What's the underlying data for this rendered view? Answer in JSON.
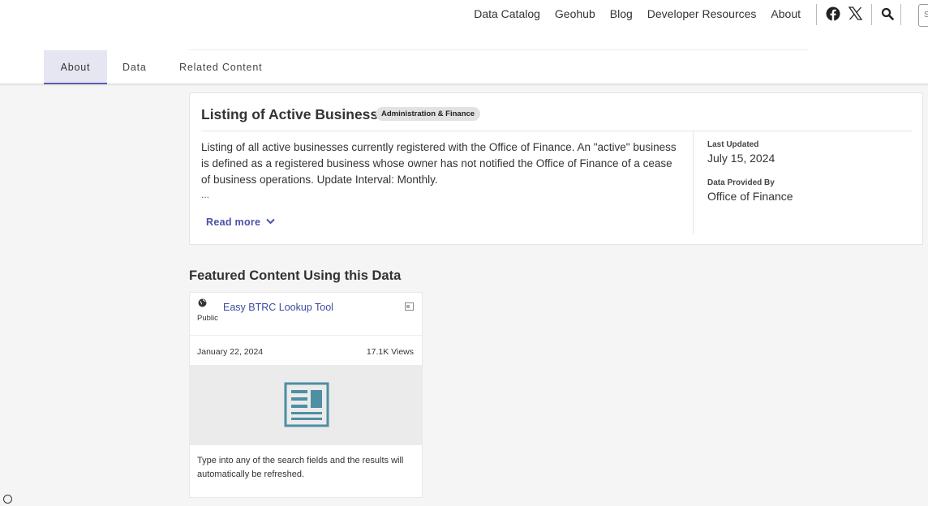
{
  "nav": {
    "links": [
      "Data Catalog",
      "Geohub",
      "Blog",
      "Developer Resources",
      "About"
    ],
    "search_placeholder": "S"
  },
  "tabs": [
    "About",
    "Data",
    "Related Content"
  ],
  "dataset": {
    "title": "Listing of Active Businesses",
    "badge": "Administration & Finance",
    "description": "Listing of all active businesses currently registered with the Office of Finance. An \"active\" business is defined as a registered business whose owner has not notified the Office of Finance of a cease of business operations. Update Interval: Monthly.",
    "ellipsis": "...",
    "read_more": "Read more",
    "last_updated_label": "Last Updated",
    "last_updated": "July 15, 2024",
    "provided_by_label": "Data Provided By",
    "provided_by": "Office of Finance"
  },
  "featured": {
    "heading": "Featured Content Using this Data",
    "item": {
      "access": "Public",
      "title": "Easy BTRC Lookup Tool",
      "date": "January 22, 2024",
      "views": "17.1K Views",
      "description": "Type into any of the search fields and the results will automatically be refreshed."
    }
  },
  "colors": {
    "accent": "#5a5db0",
    "link": "#3d4aa0",
    "thumb_icon": "#4e8fa3"
  }
}
